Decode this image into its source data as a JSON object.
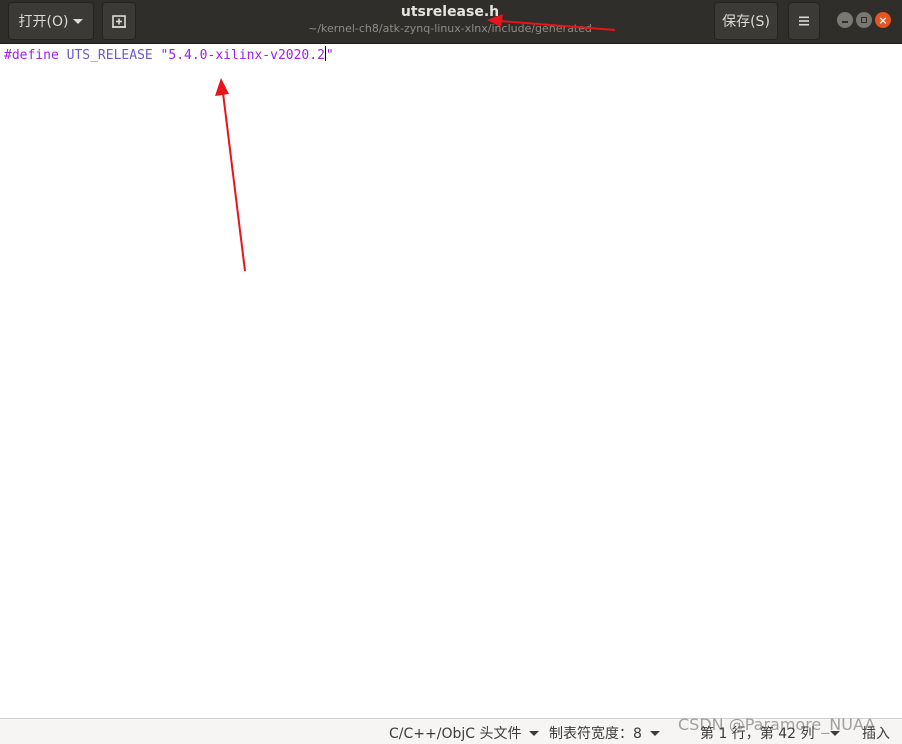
{
  "header": {
    "open_label": "打开(O)",
    "title": "utsrelease.h",
    "path": "~/kernel-ch8/atk-zynq-linux-xlnx/include/generated",
    "save_label": "保存(S)",
    "icons": {
      "open_dropdown": "chevron-down-icon",
      "new_tab": "new-document-icon",
      "menu": "hamburger-menu-icon",
      "minimize": "minimize-icon",
      "maximize": "maximize-icon",
      "close": "close-icon"
    }
  },
  "editor": {
    "code_lines": [
      {
        "directive": "#define",
        "identifier": "UTS_RELEASE",
        "string_open": "\"5.4.0-xilinx-v2020.2",
        "string_close": "\""
      }
    ]
  },
  "statusbar": {
    "language": "C/C++/ObjC 头文件",
    "tab_width": "制表符宽度：8",
    "position": "第 1 行，第 42 列",
    "mode": "插入"
  },
  "watermark": "CSDN @Paramore_NUAA",
  "colors": {
    "headerbar": "#2f2e2b",
    "close_button": "#e95420",
    "annotation_arrow": "#e8141a",
    "syntax_preprocessor": "#a020f0"
  }
}
